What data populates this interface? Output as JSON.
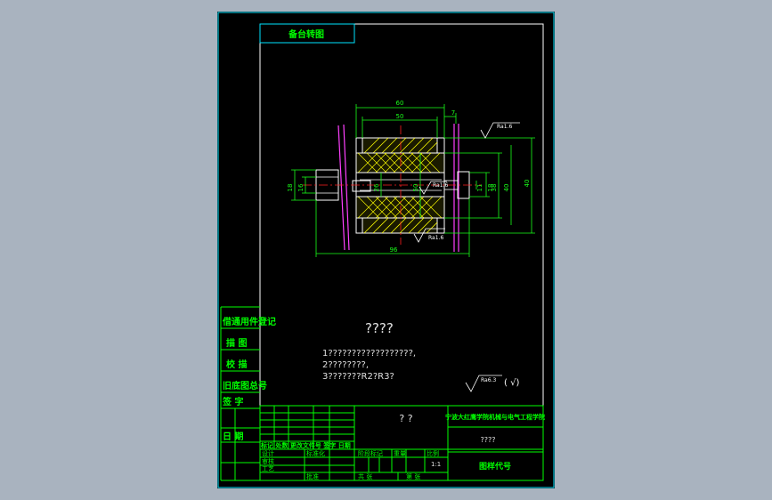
{
  "colors": {
    "background": "#a9b3bf",
    "sheet": "#000000",
    "frame": "#ffffff",
    "titleblock": "#00ff00",
    "cyan": "#00e5ff",
    "dimension": "#19ff19",
    "part": "#ffffff",
    "centerline": "#ff2020",
    "hatch": "#ffff00",
    "magenta": "#ff40ff",
    "note_text": "#e0e0e0"
  },
  "drawing": {
    "stamp_label": "备台转图",
    "dimensions": {
      "d60": "60",
      "d50": "50",
      "d7": "7",
      "d96": "96",
      "d18a": "18",
      "d16": "16",
      "d26": "26",
      "d50v": "50",
      "d11": "11",
      "d18b": "18",
      "d38": "38",
      "d40a": "40",
      "d40b": "40"
    },
    "roughness": {
      "r1": "Ra1.6",
      "r2": "Ra1.6",
      "r3": "Ra1.6"
    }
  },
  "notes": {
    "heading": "????",
    "line1": "1??????????????????,",
    "line2": "2????????,",
    "line3": "3???????R2?R3?",
    "roughness_value": "Ra6.3",
    "roughness_paren": "( √)"
  },
  "side_labels": {
    "l1": "借通用件登记",
    "l2": "描  图",
    "l3": "校  描",
    "l4": "旧底图总号",
    "l5": "签  字",
    "l6": "日  期"
  },
  "title_block": {
    "drawing_name": "? ?",
    "school": "宁波大红鹰学院机械与电气工程学院",
    "material": "????",
    "drawing_number": "图样代号",
    "header_row": "标记 处数 更改文件号 签字 日期",
    "designer": "设计",
    "standardized": "标准化",
    "stage_mark": "阶段标记",
    "weight": "重量",
    "scale": "比例",
    "scale_value": "1:1",
    "checker": "审核",
    "process": "工艺",
    "approve": "批准",
    "sheets_total": "共 张",
    "sheet_no": "第 张"
  }
}
